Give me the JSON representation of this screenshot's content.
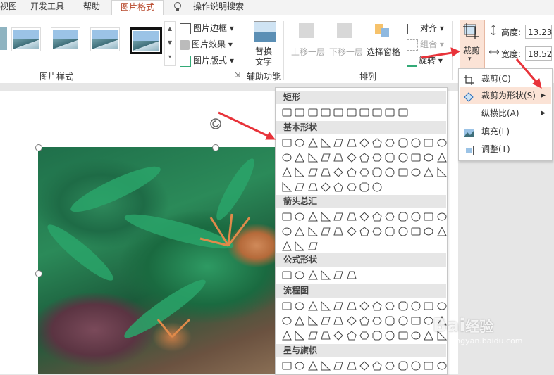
{
  "tabs": [
    "视图",
    "开发工具",
    "帮助",
    "图片格式",
    "操作说明搜索"
  ],
  "ribbon": {
    "picture_styles_label": "图片样式",
    "border_label": "图片边框",
    "effects_label": "图片效果",
    "layout_label": "图片版式",
    "alt_text_line1": "替换",
    "alt_text_line2": "文字",
    "accessibility_label": "辅助功能",
    "bring_forward": "上移一层",
    "send_backward": "下移一层",
    "selection_pane": "选择窗格",
    "align": "对齐",
    "group": "组合",
    "rotate": "旋转",
    "arrange_label": "排列",
    "crop_label": "裁剪",
    "height_label": "高度:",
    "height_value": "13.23",
    "width_label": "宽度:",
    "width_value": "18.52"
  },
  "crop_menu": {
    "items": [
      {
        "label": "裁剪(C)",
        "has_sub": false
      },
      {
        "label": "裁剪为形状(S)",
        "has_sub": true
      },
      {
        "label": "纵横比(A)",
        "has_sub": true
      },
      {
        "label": "填充(L)",
        "has_sub": false
      },
      {
        "label": "调整(T)",
        "has_sub": false
      }
    ]
  },
  "shapes_menu": {
    "categories": [
      "矩形",
      "基本形状",
      "箭头总汇",
      "公式形状",
      "流程图",
      "星与旗帜"
    ]
  },
  "watermark": {
    "line1": "Bai",
    "line2": "经验",
    "line3": "jingyan.baidu.com"
  },
  "colors": {
    "accent": "#b7472a",
    "highlight": "#fbe3d6",
    "arrow": "#e8333a"
  }
}
